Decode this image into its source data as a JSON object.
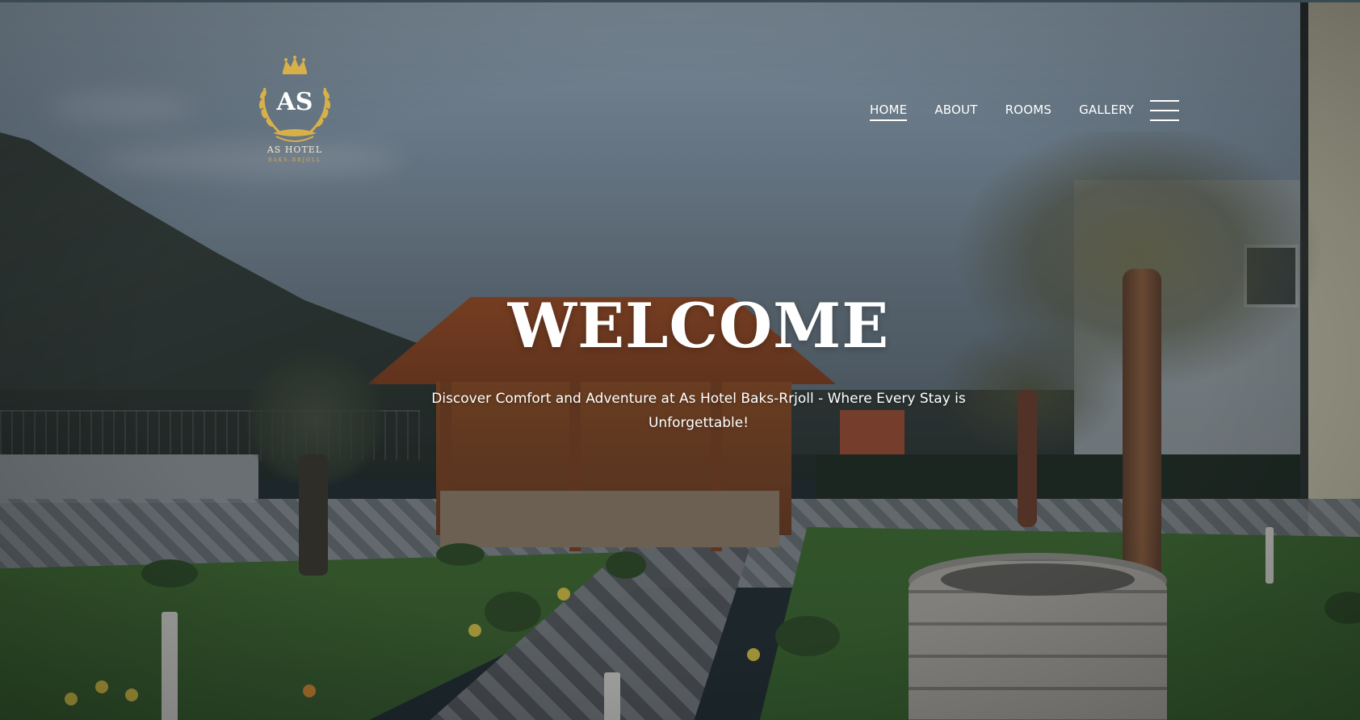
{
  "brand": {
    "initials": "AS",
    "name": "AS HOTEL",
    "location": "BAKS-RRJOLL"
  },
  "nav": {
    "items": [
      {
        "label": "HOME",
        "active": true
      },
      {
        "label": "ABOUT",
        "active": false
      },
      {
        "label": "ROOMS",
        "active": false
      },
      {
        "label": "GALLERY",
        "active": false
      }
    ],
    "menu_icon": "hamburger-icon"
  },
  "hero": {
    "title": "WELCOME",
    "subtitle": "Discover Comfort and Adventure at As Hotel Baks-Rrjoll - Where Every Stay is Unforgettable!"
  },
  "colors": {
    "brand_gold": "#d8b04a",
    "text": "#ffffff"
  }
}
